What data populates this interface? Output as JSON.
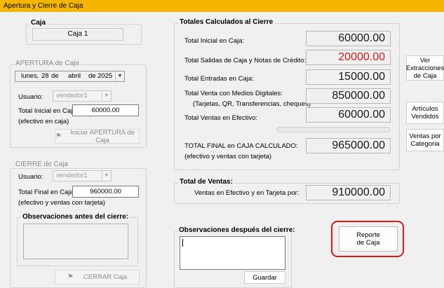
{
  "window": {
    "title": "Apertura y Cierre de Caja"
  },
  "caja": {
    "legend": "Caja",
    "value": "Caja 1"
  },
  "apertura": {
    "legend": "APERTURA de Caja",
    "date": {
      "weekday": "lunes",
      "day": "28",
      "sep": "de",
      "month": "abril",
      "sep2": "de",
      "year": "2025"
    },
    "usuario_label": "Usuario:",
    "usuario_value": "vendedor1",
    "total_inicial_label": "Total Inicial en Caja:",
    "total_inicial_sub": "(efectivo en caja)",
    "total_inicial_value": "60000.00",
    "button_label": "Iniciar APERTURA de Caja"
  },
  "cierre": {
    "legend": "CIERRE de Caja",
    "usuario_label": "Usuario:",
    "usuario_value": "vendedor1",
    "total_final_label": "Total Final en Caja:",
    "total_final_sub": "(efectivo y ventas con tarjeta)",
    "total_final_value": "960000.00",
    "observaciones_legend": "Observaciones antes del cierre:",
    "button_label": "CERRAR Caja"
  },
  "totales": {
    "legend": "Totales Calculados al Cierre",
    "rows": [
      {
        "label": "Total Inicial en Caja:",
        "value": "60000.00"
      },
      {
        "label": "Total Salidas de Caja y Notas de Crédito:",
        "value": "20000.00"
      },
      {
        "label": "Total Entradas en Caja:",
        "value": "15000.00"
      },
      {
        "label": "Total Venta con Medios Digitales:",
        "sub": "(Tarjetas, QR, Transferencias, cheques)",
        "value": "850000.00"
      },
      {
        "label": "Total Ventas en Efectivo:",
        "value": "60000.00"
      },
      {
        "label": "TOTAL FINAL en CAJA CALCULADO:",
        "sub": "(efectivo y ventas con tarjeta)",
        "value": "965000.00"
      }
    ],
    "progress": 0
  },
  "total_ventas": {
    "legend": "Total de Ventas:",
    "label": "Ventas en Efectivo y en Tarjeta por:",
    "value": "910000.00"
  },
  "obs_despues": {
    "legend": "Observaciones después del cierre:",
    "button_label": "Guardar"
  },
  "side_buttons": {
    "ver_extracciones": "Ver Extracciones de Caja",
    "articulos_vendidos": "Artículos Vendidos",
    "ventas_por_categoria": "Ventas por Categoria",
    "reporte": "Reporte de Caja"
  },
  "colors": {
    "title_bar": "#f5b400",
    "highlight": "#e01818",
    "progress": "#06b025"
  }
}
